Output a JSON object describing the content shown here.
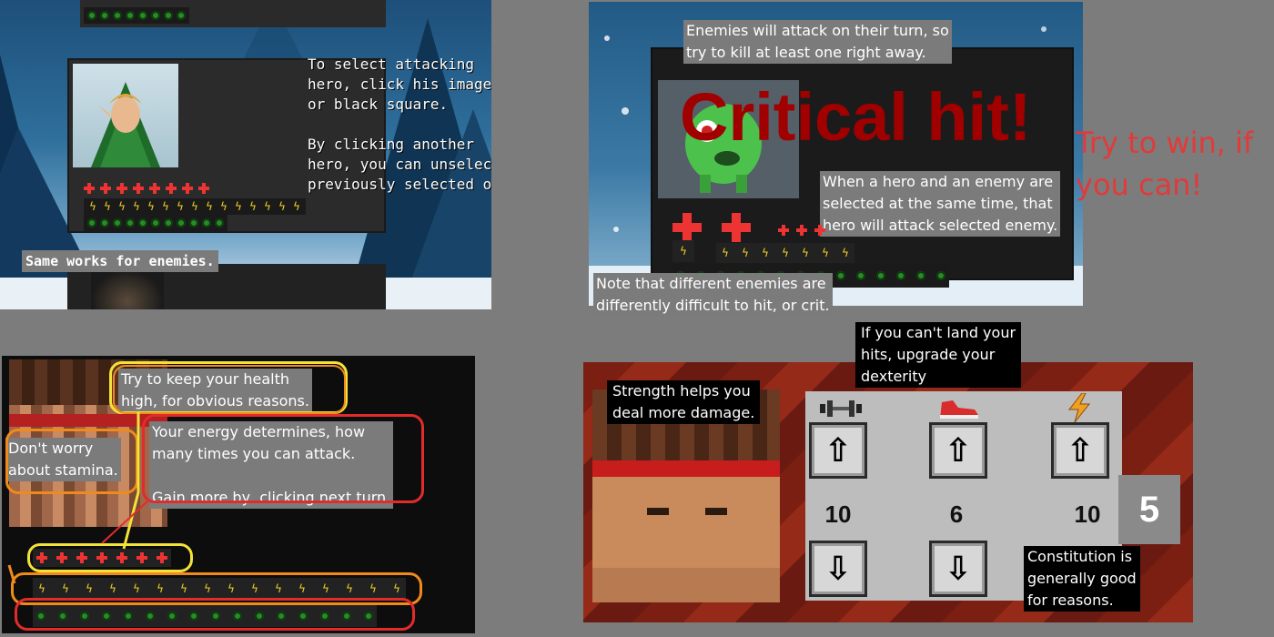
{
  "panel1": {
    "instructions": "To select attacking\nhero, click his image,\nor black square.\n\nBy clicking another\nhero, you can unselect\npreviously selected one.",
    "same_works": "Same works for enemies."
  },
  "panel2": {
    "tip_enemies": "Enemies will attack on their turn, so\ntry to kill at least one right away.",
    "critical": "Critical hit!",
    "tip_selected": "When a hero and an enemy are\nselected at the same time, that\nhero will attack selected enemy.",
    "tip_difficulty": "Note that different enemies are\ndifferently difficult to hit, or crit."
  },
  "win_text": "Try to win, if\nyou can!",
  "panel3": {
    "tip_health": "Try to keep your health\nhigh, for obvious reasons.",
    "tip_stamina": "Don't worry\nabout stamina.",
    "tip_energy": "Your energy determines, how\nmany times you can attack.\n\nGain more by  clicking next turn."
  },
  "panel4": {
    "tip_dexterity": "If you can't land your\nhits, upgrade your\ndexterity",
    "tip_strength": "Strength helps you\ndeal more damage.",
    "tip_constitution": "Constitution is\ngenerally good\nfor reasons.",
    "stats": {
      "strength": "10",
      "dexterity": "6",
      "constitution": "10"
    },
    "points": "5",
    "up_glyph": "⇧",
    "down_glyph": "⇩"
  },
  "colors": {
    "health": "#e33333",
    "energy": "#f5d423",
    "stamina": "#2a8a2a",
    "critical": "#a00000",
    "win": "#e23a3a"
  },
  "icons": {
    "strength": "dumbbell-icon",
    "dexterity": "sneaker-icon",
    "constitution": "lightning-icon"
  }
}
